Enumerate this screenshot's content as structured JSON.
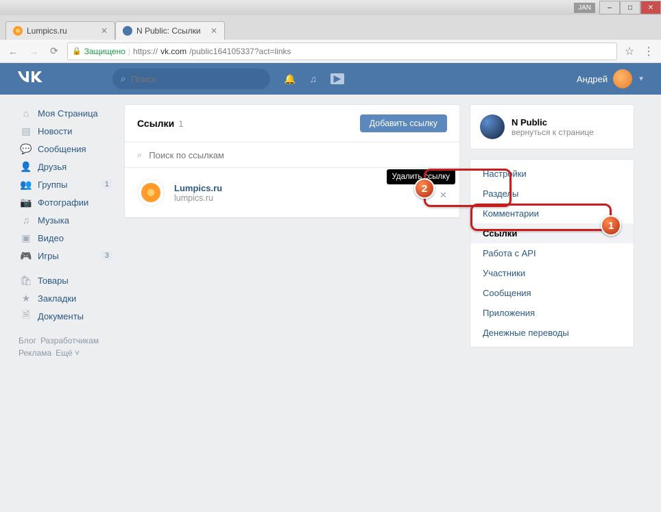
{
  "window": {
    "indicator": "JAN"
  },
  "tabs": [
    {
      "title": "Lumpics.ru"
    },
    {
      "title": "N Public: Ссылки"
    }
  ],
  "address": {
    "secure_label": "Защищено",
    "protocol": "https://",
    "host": "vk.com",
    "path": "/public164105337?act=links"
  },
  "header": {
    "search_placeholder": "Поиск",
    "username": "Андрей"
  },
  "leftnav": {
    "items": [
      {
        "label": "Моя Страница"
      },
      {
        "label": "Новости"
      },
      {
        "label": "Сообщения"
      },
      {
        "label": "Друзья"
      },
      {
        "label": "Группы",
        "badge": "1"
      },
      {
        "label": "Фотографии"
      },
      {
        "label": "Музыка"
      },
      {
        "label": "Видео"
      },
      {
        "label": "Игры",
        "badge": "3"
      }
    ],
    "items2": [
      {
        "label": "Товары"
      },
      {
        "label": "Закладки"
      },
      {
        "label": "Документы"
      }
    ],
    "footer": [
      "Блог",
      "Разработчикам",
      "Реклама",
      "Ещё ˅"
    ]
  },
  "center": {
    "title": "Ссылки",
    "count": "1",
    "add_button": "Добавить ссылку",
    "search_placeholder": "Поиск по ссылкам",
    "link": {
      "title": "Lumpics.ru",
      "subtitle": "lumpics.ru"
    },
    "tooltip": "Удалить ссылку"
  },
  "right": {
    "group": {
      "name": "N Public",
      "back": "вернуться к странице"
    },
    "menu": [
      "Настройки",
      "Разделы",
      "Комментарии",
      "Ссылки",
      "Работа с API",
      "Участники",
      "Сообщения",
      "Приложения",
      "Денежные переводы"
    ]
  },
  "annotations": {
    "n1": "1",
    "n2": "2"
  }
}
